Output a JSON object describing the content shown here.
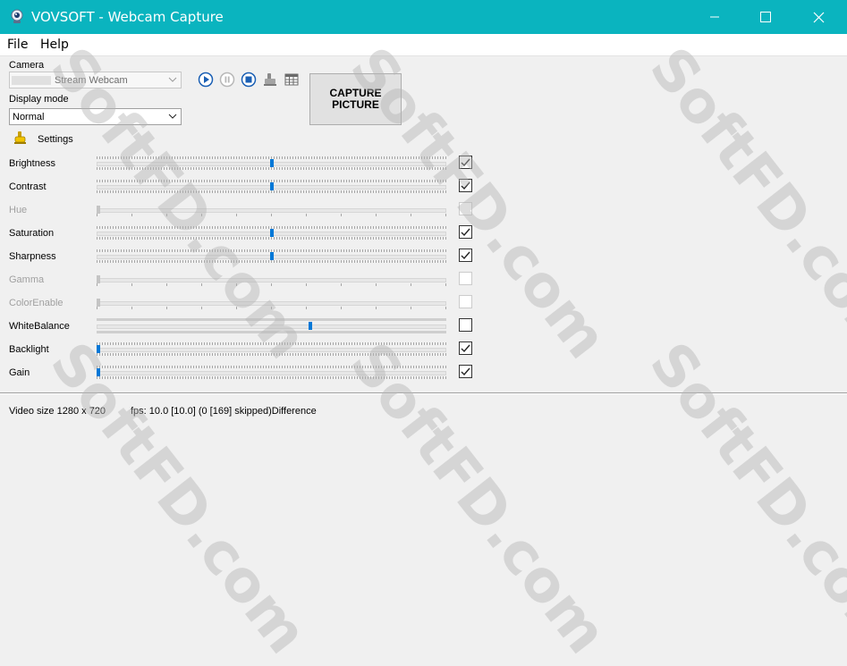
{
  "window": {
    "title": "VOVSOFT - Webcam Capture"
  },
  "menu": {
    "file": "File",
    "help": "Help"
  },
  "camera": {
    "label": "Camera",
    "selected": "Stream Webcam"
  },
  "display_mode": {
    "label": "Display mode",
    "selected": "Normal"
  },
  "toolbar": {
    "icons": [
      "play-icon",
      "pause-icon",
      "stop-icon",
      "settings-icon",
      "grid-icon"
    ]
  },
  "capture": {
    "label": "CAPTURE\nPICTURE"
  },
  "settings": {
    "label": "Settings"
  },
  "properties": [
    {
      "name": "Brightness",
      "enabled": true,
      "checked": true,
      "value": 0.5
    },
    {
      "name": "Contrast",
      "enabled": true,
      "checked": true,
      "value": 0.5
    },
    {
      "name": "Hue",
      "enabled": false,
      "checked": false,
      "value": 0
    },
    {
      "name": "Saturation",
      "enabled": true,
      "checked": true,
      "value": 0.5
    },
    {
      "name": "Sharpness",
      "enabled": true,
      "checked": true,
      "value": 0.5
    },
    {
      "name": "Gamma",
      "enabled": false,
      "checked": false,
      "value": 0
    },
    {
      "name": "ColorEnable",
      "enabled": false,
      "checked": false,
      "value": 0
    },
    {
      "name": "WhiteBalance",
      "enabled": true,
      "checked": false,
      "value": 0.61
    },
    {
      "name": "Backlight",
      "enabled": true,
      "checked": true,
      "value": 0
    },
    {
      "name": "Gain",
      "enabled": true,
      "checked": true,
      "value": 0
    }
  ],
  "status": {
    "video_size": "Video size 1280 x 720",
    "fps": "fps: 10.0 [10.0] (0 [169] skipped)Difference"
  },
  "watermark": {
    "text": "SoftFD.com"
  },
  "colors": {
    "titlebar": "#0ab4bf",
    "accent": "#0078d7"
  }
}
